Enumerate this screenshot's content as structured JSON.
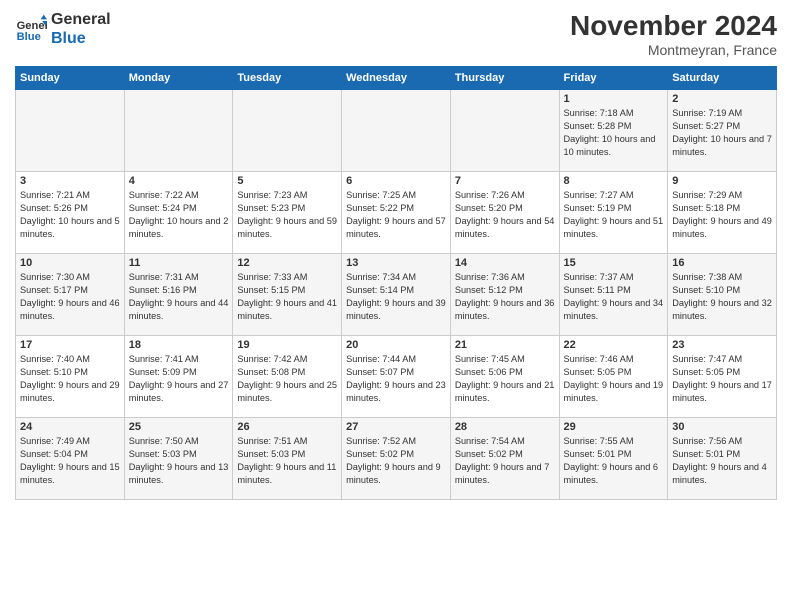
{
  "logo": {
    "line1": "General",
    "line2": "Blue"
  },
  "title": "November 2024",
  "location": "Montmeyran, France",
  "weekdays": [
    "Sunday",
    "Monday",
    "Tuesday",
    "Wednesday",
    "Thursday",
    "Friday",
    "Saturday"
  ],
  "weeks": [
    [
      {
        "day": "",
        "info": ""
      },
      {
        "day": "",
        "info": ""
      },
      {
        "day": "",
        "info": ""
      },
      {
        "day": "",
        "info": ""
      },
      {
        "day": "",
        "info": ""
      },
      {
        "day": "1",
        "info": "Sunrise: 7:18 AM\nSunset: 5:28 PM\nDaylight: 10 hours and 10 minutes."
      },
      {
        "day": "2",
        "info": "Sunrise: 7:19 AM\nSunset: 5:27 PM\nDaylight: 10 hours and 7 minutes."
      }
    ],
    [
      {
        "day": "3",
        "info": "Sunrise: 7:21 AM\nSunset: 5:26 PM\nDaylight: 10 hours and 5 minutes."
      },
      {
        "day": "4",
        "info": "Sunrise: 7:22 AM\nSunset: 5:24 PM\nDaylight: 10 hours and 2 minutes."
      },
      {
        "day": "5",
        "info": "Sunrise: 7:23 AM\nSunset: 5:23 PM\nDaylight: 9 hours and 59 minutes."
      },
      {
        "day": "6",
        "info": "Sunrise: 7:25 AM\nSunset: 5:22 PM\nDaylight: 9 hours and 57 minutes."
      },
      {
        "day": "7",
        "info": "Sunrise: 7:26 AM\nSunset: 5:20 PM\nDaylight: 9 hours and 54 minutes."
      },
      {
        "day": "8",
        "info": "Sunrise: 7:27 AM\nSunset: 5:19 PM\nDaylight: 9 hours and 51 minutes."
      },
      {
        "day": "9",
        "info": "Sunrise: 7:29 AM\nSunset: 5:18 PM\nDaylight: 9 hours and 49 minutes."
      }
    ],
    [
      {
        "day": "10",
        "info": "Sunrise: 7:30 AM\nSunset: 5:17 PM\nDaylight: 9 hours and 46 minutes."
      },
      {
        "day": "11",
        "info": "Sunrise: 7:31 AM\nSunset: 5:16 PM\nDaylight: 9 hours and 44 minutes."
      },
      {
        "day": "12",
        "info": "Sunrise: 7:33 AM\nSunset: 5:15 PM\nDaylight: 9 hours and 41 minutes."
      },
      {
        "day": "13",
        "info": "Sunrise: 7:34 AM\nSunset: 5:14 PM\nDaylight: 9 hours and 39 minutes."
      },
      {
        "day": "14",
        "info": "Sunrise: 7:36 AM\nSunset: 5:12 PM\nDaylight: 9 hours and 36 minutes."
      },
      {
        "day": "15",
        "info": "Sunrise: 7:37 AM\nSunset: 5:11 PM\nDaylight: 9 hours and 34 minutes."
      },
      {
        "day": "16",
        "info": "Sunrise: 7:38 AM\nSunset: 5:10 PM\nDaylight: 9 hours and 32 minutes."
      }
    ],
    [
      {
        "day": "17",
        "info": "Sunrise: 7:40 AM\nSunset: 5:10 PM\nDaylight: 9 hours and 29 minutes."
      },
      {
        "day": "18",
        "info": "Sunrise: 7:41 AM\nSunset: 5:09 PM\nDaylight: 9 hours and 27 minutes."
      },
      {
        "day": "19",
        "info": "Sunrise: 7:42 AM\nSunset: 5:08 PM\nDaylight: 9 hours and 25 minutes."
      },
      {
        "day": "20",
        "info": "Sunrise: 7:44 AM\nSunset: 5:07 PM\nDaylight: 9 hours and 23 minutes."
      },
      {
        "day": "21",
        "info": "Sunrise: 7:45 AM\nSunset: 5:06 PM\nDaylight: 9 hours and 21 minutes."
      },
      {
        "day": "22",
        "info": "Sunrise: 7:46 AM\nSunset: 5:05 PM\nDaylight: 9 hours and 19 minutes."
      },
      {
        "day": "23",
        "info": "Sunrise: 7:47 AM\nSunset: 5:05 PM\nDaylight: 9 hours and 17 minutes."
      }
    ],
    [
      {
        "day": "24",
        "info": "Sunrise: 7:49 AM\nSunset: 5:04 PM\nDaylight: 9 hours and 15 minutes."
      },
      {
        "day": "25",
        "info": "Sunrise: 7:50 AM\nSunset: 5:03 PM\nDaylight: 9 hours and 13 minutes."
      },
      {
        "day": "26",
        "info": "Sunrise: 7:51 AM\nSunset: 5:03 PM\nDaylight: 9 hours and 11 minutes."
      },
      {
        "day": "27",
        "info": "Sunrise: 7:52 AM\nSunset: 5:02 PM\nDaylight: 9 hours and 9 minutes."
      },
      {
        "day": "28",
        "info": "Sunrise: 7:54 AM\nSunset: 5:02 PM\nDaylight: 9 hours and 7 minutes."
      },
      {
        "day": "29",
        "info": "Sunrise: 7:55 AM\nSunset: 5:01 PM\nDaylight: 9 hours and 6 minutes."
      },
      {
        "day": "30",
        "info": "Sunrise: 7:56 AM\nSunset: 5:01 PM\nDaylight: 9 hours and 4 minutes."
      }
    ]
  ]
}
